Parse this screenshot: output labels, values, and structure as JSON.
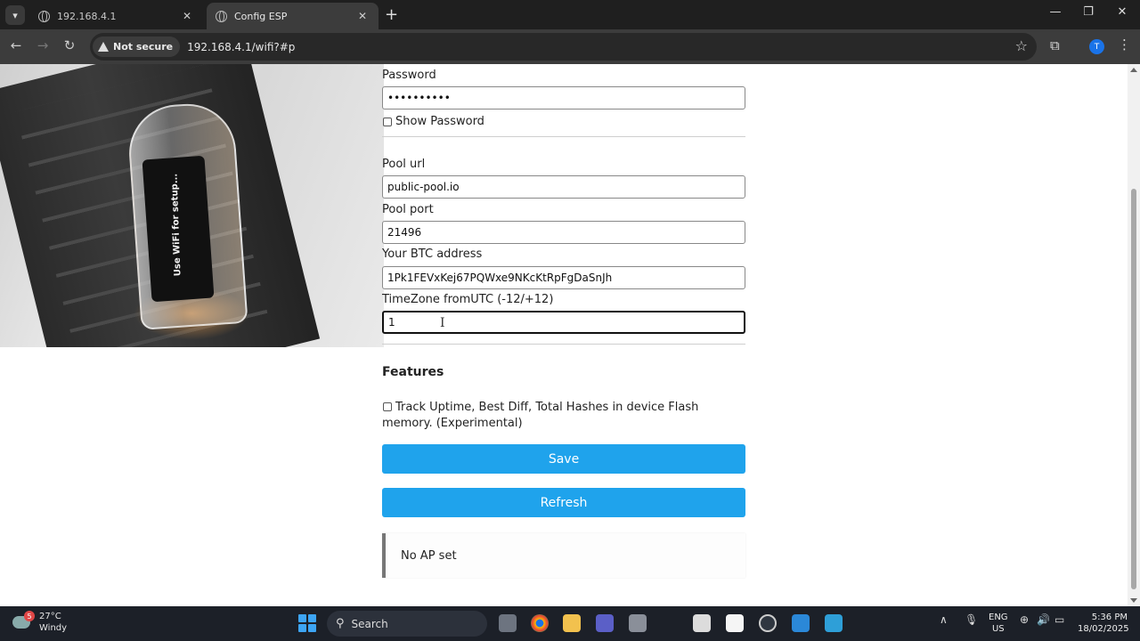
{
  "browser": {
    "tabs": [
      {
        "title": "192.168.4.1",
        "active": false
      },
      {
        "title": "Config ESP",
        "active": true
      }
    ],
    "security_label": "Not secure",
    "url": "192.168.4.1/wifi?#p",
    "profile_initial": "T"
  },
  "photo": {
    "screen_text": "Use WiFi for setup..."
  },
  "form": {
    "password_label": "Password",
    "password_value": "••••••••••",
    "show_password_label": "Show Password",
    "pool_url_label": "Pool url",
    "pool_url_value": "public-pool.io",
    "pool_port_label": "Pool port",
    "pool_port_value": "21496",
    "btc_address_label": "Your BTC address",
    "btc_address_value": "1Pk1FEVxKej67PQWxe9NKcKtRpFgDaSnJh",
    "timezone_label": "TimeZone fromUTC (-12/+12)",
    "timezone_value": "1",
    "features_heading": "Features",
    "feature_track_label": "Track Uptime, Best Diff, Total Hashes in device Flash memory. (Experimental)",
    "save_label": "Save",
    "refresh_label": "Refresh",
    "status_message": "No AP set"
  },
  "taskbar": {
    "weather_temp": "27°C",
    "weather_desc": "Windy",
    "weather_badge": "5",
    "search_label": "Search",
    "lang_line1": "ENG",
    "lang_line2": "US",
    "time": "5:36 PM",
    "date": "18/02/2025"
  },
  "colors": {
    "button": "#1fa3ec",
    "chrome_dark": "#1f1f1f",
    "taskbar": "#1c2028"
  }
}
